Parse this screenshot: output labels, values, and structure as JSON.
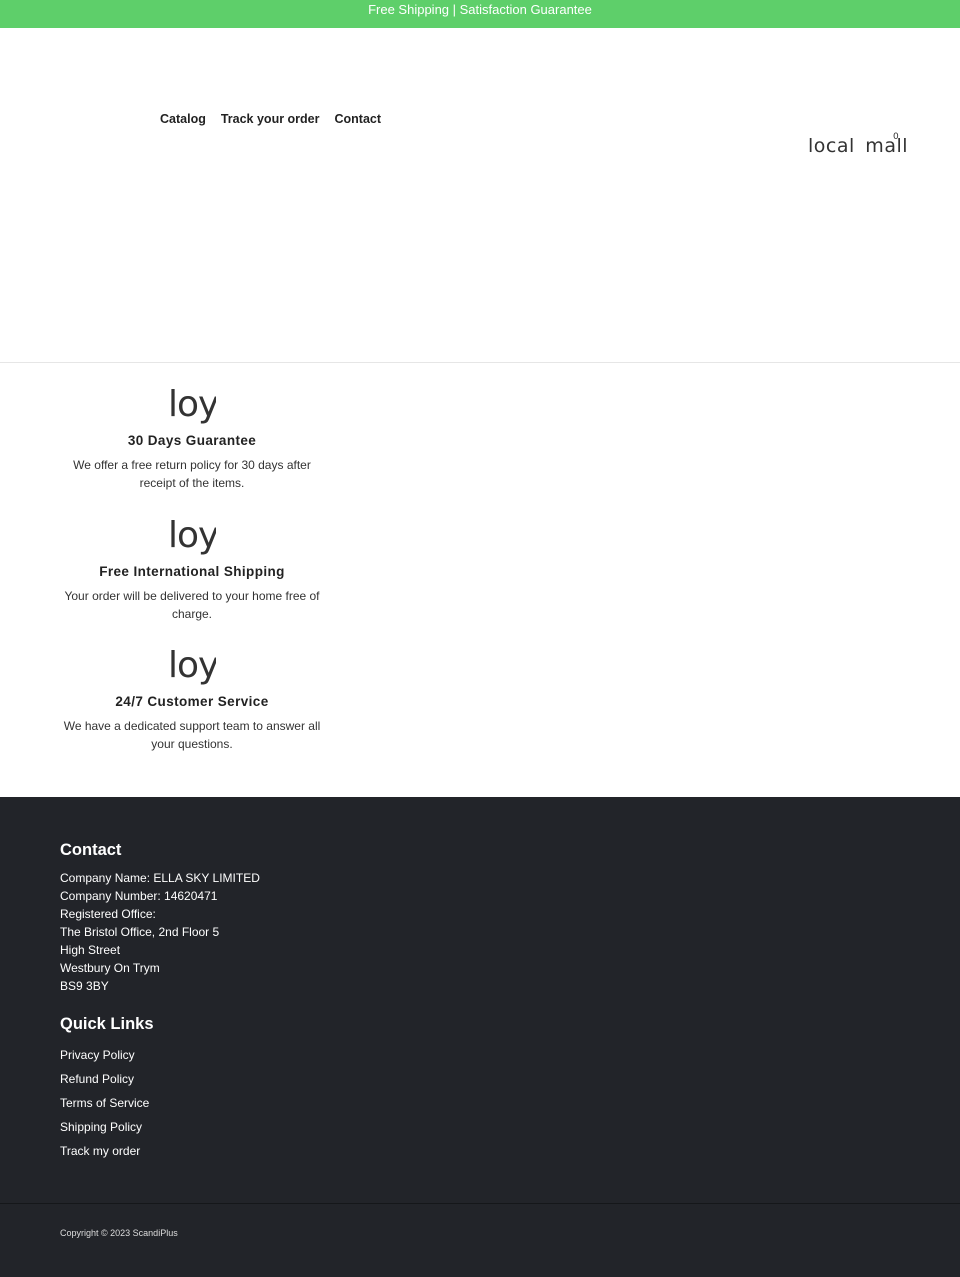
{
  "announcement": "Free Shipping | Satisfaction Guarantee",
  "nav": {
    "items": [
      {
        "label": "Catalog"
      },
      {
        "label": "Track your order"
      },
      {
        "label": "Contact"
      }
    ]
  },
  "brand": {
    "logo_text": "local mall",
    "cart_count": "0"
  },
  "features": [
    {
      "icon": "loy",
      "title": "30 Days Guarantee",
      "text": "We offer a free return policy for 30 days after receipt of the items."
    },
    {
      "icon": "loy",
      "title": "Free International Shipping",
      "text": "Your order will be delivered to your home free of charge."
    },
    {
      "icon": "loy",
      "title": "24/7 Customer Service",
      "text": "We have a dedicated support team to answer all your questions."
    }
  ],
  "footer": {
    "contact": {
      "heading": "Contact",
      "lines": [
        "Company Name: ELLA SKY LIMITED",
        "Company Number: 14620471",
        "Registered Office:",
        "The Bristol Office, 2nd Floor 5",
        "High Street",
        "Westbury On Trym",
        "BS9 3BY"
      ]
    },
    "quick_links": {
      "heading": "Quick Links",
      "links": [
        "Privacy Policy",
        "Refund Policy",
        "Terms of Service",
        "Shipping Policy",
        "Track my order"
      ]
    },
    "copyright": "Copyright © 2023 ScandiPlus"
  },
  "colors": {
    "announcement_bg": "#5ecf6a",
    "footer_bg": "#222429"
  }
}
